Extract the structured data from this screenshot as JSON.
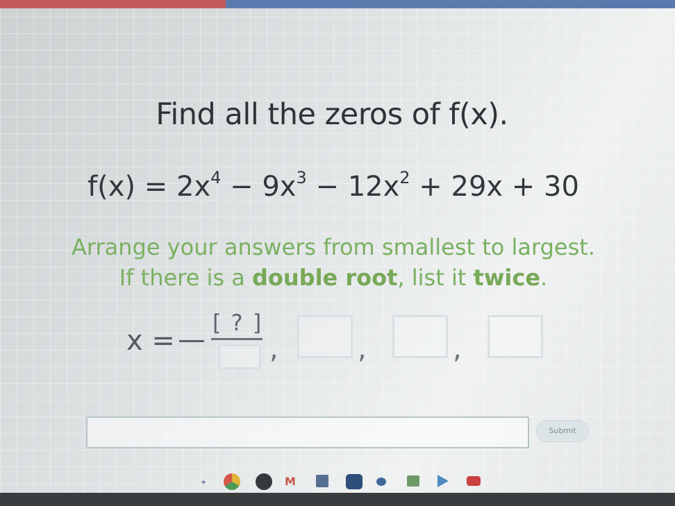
{
  "title": "Find all the zeros of f(x).",
  "equation": {
    "lhs": "f(x) = 2x",
    "exp1": "4",
    "t2": " − 9x",
    "exp2": "3",
    "t3": " − 12x",
    "exp3": "2",
    "t4": " + 29x + 30"
  },
  "instructions": {
    "line1": "Arrange your answers from smallest to largest.",
    "line2_pre": "If there is a ",
    "line2_bold1": "double root",
    "line2_mid": ", list it ",
    "line2_bold2": "twice",
    "line2_post": "."
  },
  "answer": {
    "x_label": "x =",
    "numerator": "[ ? ]",
    "comma": ","
  },
  "submit_label": "Submit",
  "colors": {
    "topbar": "#5b79ad",
    "progress": "#c25a5a",
    "instruction_text": "#7ab060"
  },
  "taskbar_icons": [
    "launcher-icon",
    "chrome-icon",
    "apps-icon",
    "gmail-icon",
    "calendar-icon",
    "files-icon",
    "meet-icon",
    "classroom-icon",
    "play-store-icon",
    "youtube-icon"
  ]
}
